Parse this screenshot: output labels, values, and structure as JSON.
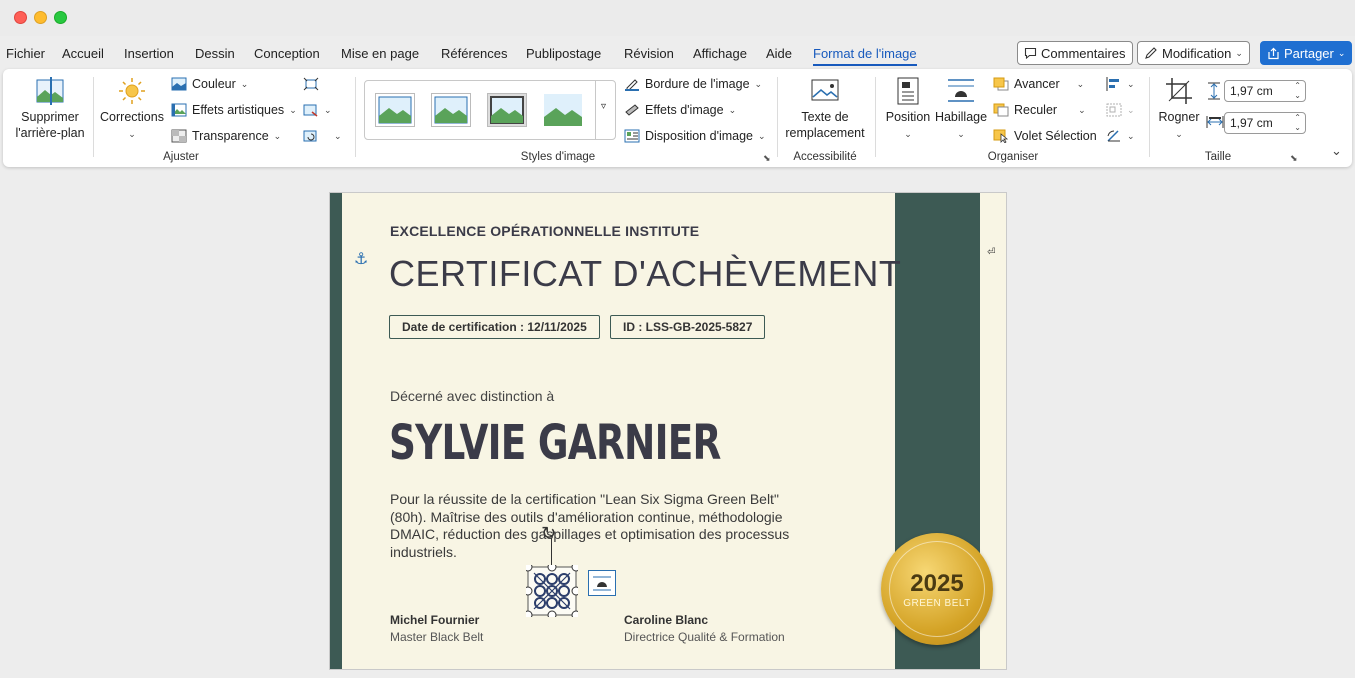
{
  "menu_tabs": [
    "Fichier",
    "Accueil",
    "Insertion",
    "Dessin",
    "Conception",
    "Mise en page",
    "Références",
    "Publipostage",
    "Révision",
    "Affichage",
    "Aide",
    "Format de l'image"
  ],
  "toolbar": {
    "comments_label": "Commentaires",
    "edit_label": "Modification",
    "share_label": "Partager"
  },
  "ribbon": {
    "ajuster": {
      "label": "Ajuster",
      "remove_bg_line1": "Supprimer",
      "remove_bg_line2": "l'arrière-plan",
      "corrections": "Corrections",
      "color": "Couleur",
      "artistic": "Effets artistiques",
      "transparency": "Transparence"
    },
    "styles": {
      "label": "Styles d'image",
      "border": "Bordure de l'image",
      "effects": "Effets d'image",
      "layout": "Disposition d'image"
    },
    "accessibility": {
      "label": "Accessibilité",
      "alt_text_line1": "Texte de",
      "alt_text_line2": "remplacement"
    },
    "organize": {
      "label": "Organiser",
      "position": "Position",
      "wrap": "Habillage",
      "forward": "Avancer",
      "backward": "Reculer",
      "selection_pane": "Volet Sélection"
    },
    "size": {
      "label": "Taille",
      "crop": "Rogner",
      "height": "1,97 cm",
      "width": "1,97 cm"
    }
  },
  "certificate": {
    "institute": "EXCELLENCE OPÉRATIONNELLE INSTITUTE",
    "title": "CERTIFICAT D'ACHÈVEMENT",
    "date_badge": "Date de certification : 12/11/2025",
    "id_badge": "ID : LSS-GB-2025-5827",
    "awarded": "Décerné avec distinction à",
    "recipient": "SYLVIE GARNIER",
    "description": "Pour la réussite de la certification \"Lean Six Sigma Green Belt\" (80h). Maîtrise des outils d'amélioration continue, méthodologie DMAIC, réduction des gaspillages et optimisation des processus industriels.",
    "signer1_name": "Michel Fournier",
    "signer1_role": "Master Black Belt",
    "signer2_name": "Caroline Blanc",
    "signer2_role": "Directrice Qualité & Formation",
    "seal_year": "2025",
    "seal_text": "GREEN BELT"
  },
  "colors": {
    "accent": "#185abd",
    "share": "#1f6fd1",
    "cert_green": "#3d5a54",
    "paper": "#f8f5e4",
    "gold": "#d4a326"
  }
}
